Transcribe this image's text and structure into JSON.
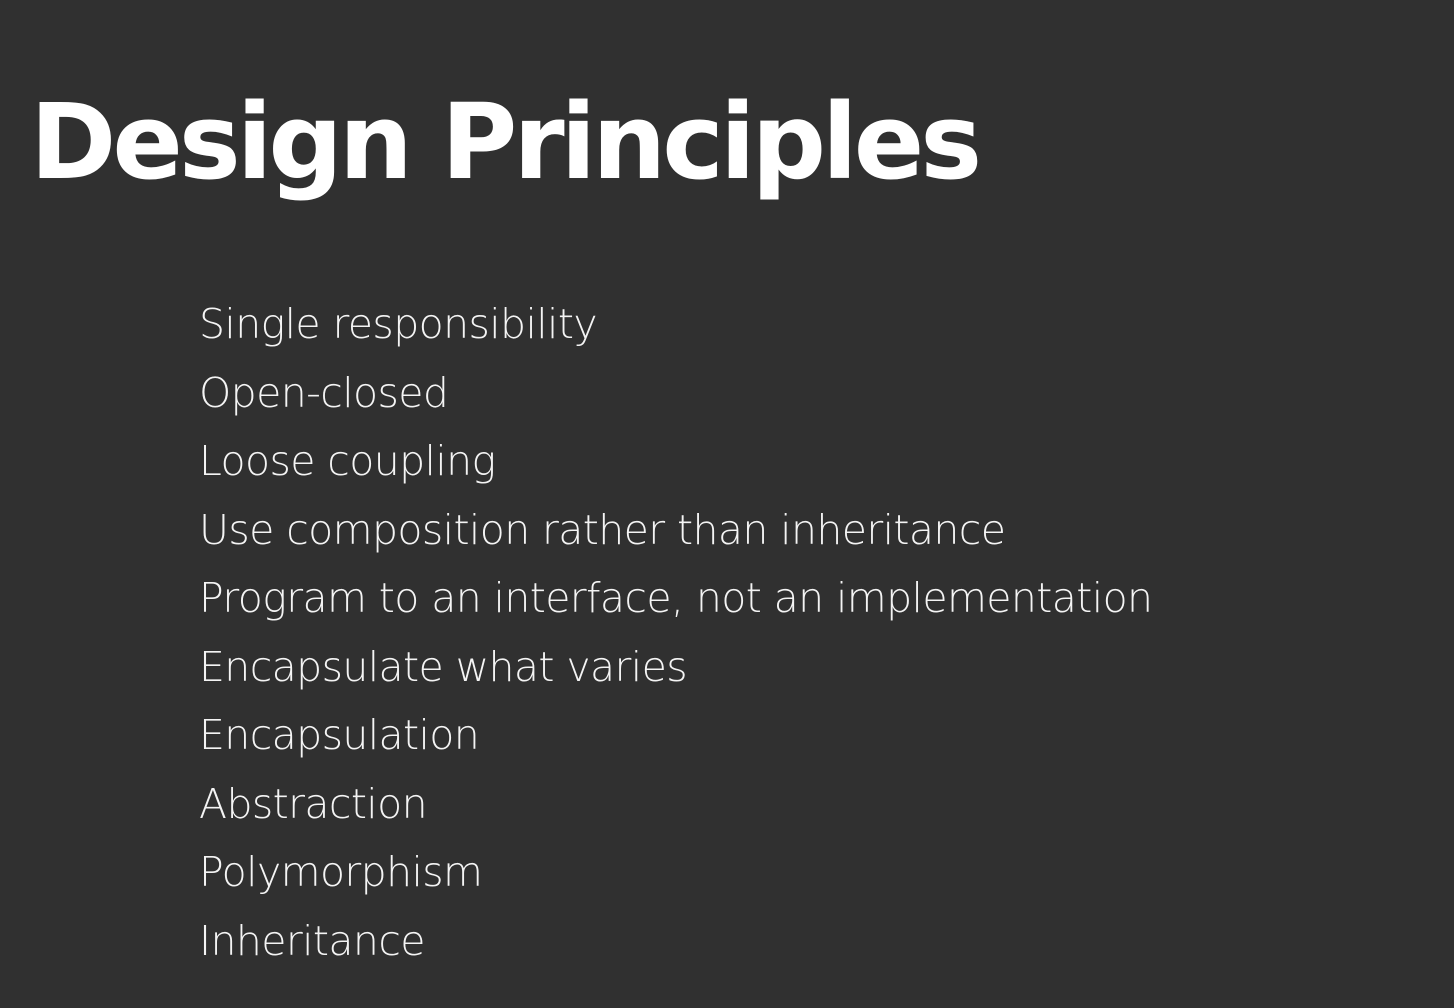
{
  "slide": {
    "title": "Design Principles",
    "principles": [
      "Single responsibility",
      "Open-closed",
      "Loose coupling",
      "Use composition rather than inheritance",
      "Program to an interface, not an implementation",
      "Encapsulate what varies",
      "Encapsulation",
      "Abstraction",
      "Polymorphism",
      "Inheritance"
    ]
  },
  "colors": {
    "background": "#303030",
    "title": "#ffffff",
    "text": "#f4f4f4"
  }
}
